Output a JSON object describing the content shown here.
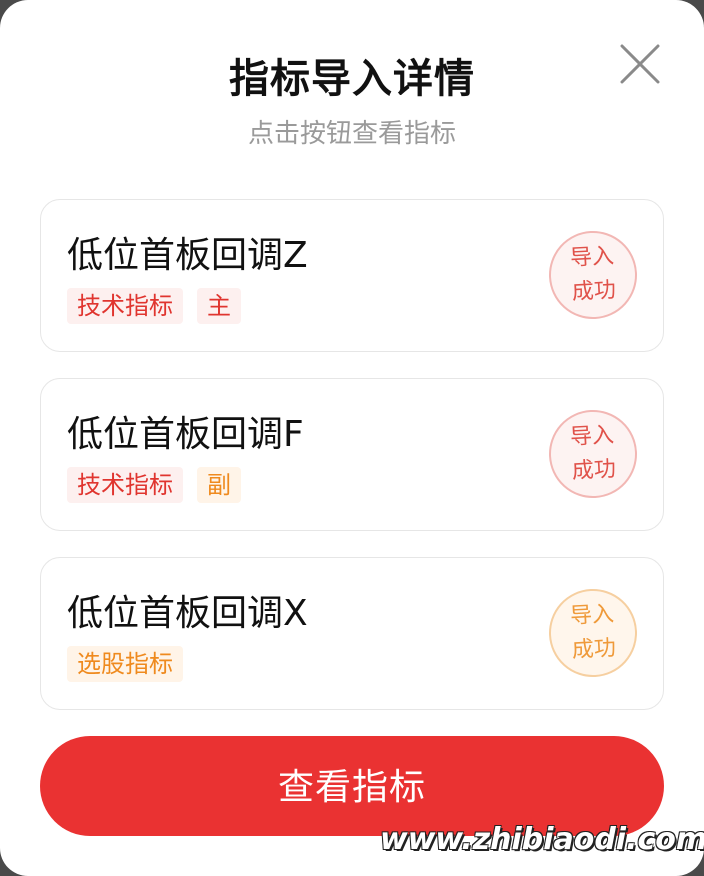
{
  "dialog": {
    "title": "指标导入详情",
    "subtitle": "点击按钮查看指标",
    "close_icon": "close-icon"
  },
  "cards": [
    {
      "name": "低位首板回调Z",
      "tags": [
        {
          "label": "技术指标",
          "color": "#e0352f"
        },
        {
          "label": "主",
          "color": "#e0352f"
        }
      ],
      "stamp": {
        "line1": "导入",
        "line2": "成功",
        "color": "#e0524a"
      }
    },
    {
      "name": "低位首板回调F",
      "tags": [
        {
          "label": "技术指标",
          "color": "#e0352f"
        },
        {
          "label": "副",
          "color": "#ef8a1e"
        }
      ],
      "stamp": {
        "line1": "导入",
        "line2": "成功",
        "color": "#e0524a"
      }
    },
    {
      "name": "低位首板回调X",
      "tags": [
        {
          "label": "选股指标",
          "color": "#ef8a1e"
        }
      ],
      "stamp": {
        "line1": "导入",
        "line2": "成功",
        "color": "#ef9a3a"
      }
    }
  ],
  "footer": {
    "view_button_label": "查看指标",
    "button_color": "#ea3232"
  },
  "watermark": "www.zhibiaodi.com"
}
